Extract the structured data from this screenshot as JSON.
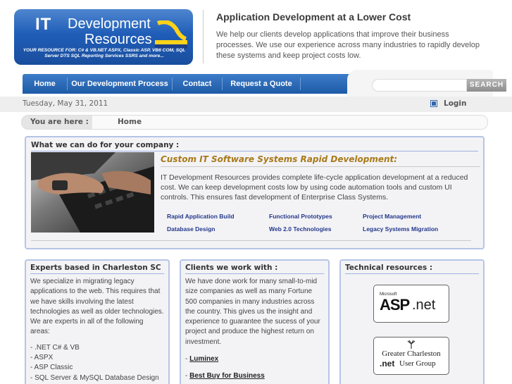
{
  "header": {
    "logo": {
      "it_text": "IT",
      "line1": "Development",
      "line2": "Resources",
      "tagline": "YOUR RESOURCE FOR: C# & VB.NET ASPX, Classic ASP, VB6 COM, SQL Server DTS SQL Reporting Services SSRS and more..."
    },
    "headline": "Application Development at a Lower Cost",
    "intro": "We help our clients develop applications that improve their business processes. We use our experience across many industries to rapidly develop these systems and keep project costs low."
  },
  "nav": {
    "items": [
      "Home",
      "Our Development Process",
      "Contact",
      "Request a Quote"
    ],
    "search_button": "SEARCH",
    "search_placeholder": ""
  },
  "strip": {
    "date": "Tuesday, May 31, 2011",
    "login": "Login"
  },
  "breadcrumb": {
    "prefix": "You are here :",
    "current": "Home"
  },
  "main": {
    "title": "What we can do for your company :",
    "heading": "Custom IT Software Systems Rapid Development:",
    "description": "IT Development Resources provides complete life-cycle application development at a reduced cost. We can keep development costs low by using code automation tools and custom UI controls. This ensures fast development of Enterprise Class Systems.",
    "services": [
      "Rapid Application Build",
      "Functional Prototypes",
      "Project Management",
      "Database Design",
      "Web 2.0 Technologies",
      "Legacy Systems Migration"
    ]
  },
  "experts": {
    "title": "Experts based in Charleston SC",
    "text": "We specialize in migrating legacy applications to the web. This requires that we have skills involving the latest technologies as well as older technologies.   We are experts in all of the following areas:",
    "items": [
      "- .NET C# & VB",
      "- ASPX",
      "- ASP Classic",
      "- SQL Server & MySQL Database Design"
    ]
  },
  "clients": {
    "title": "Clients we work with :",
    "text": "We have done work for many small-to-mid size companies as well as many Fortune 500 companies in many industries across the country.  This gives us the insight and experience to guarantee the sucess of your project and produce the highest return on investment.",
    "dash": "- ",
    "links": [
      "Luminex",
      "Best Buy for Business"
    ]
  },
  "resources": {
    "title": "Technical resources :",
    "aspnet": {
      "microsoft": "Microsoft",
      "asp": "ASP",
      "net": ".net"
    },
    "charleston": {
      "line1": "Greater Charleston",
      "net": ".net",
      "user_group": "User Group"
    }
  }
}
